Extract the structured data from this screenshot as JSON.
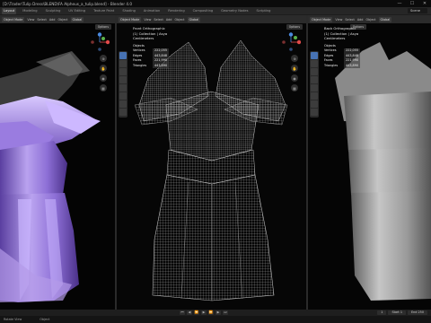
{
  "window": {
    "title": "[D:\\Trader\\Tulip Dress\\BLEND\\FA Alpheus_a_tulip.blend] - Blender 4.0",
    "minimize": "—",
    "maximize": "☐",
    "close": "✕"
  },
  "workspaces": [
    "Layout",
    "Modeling",
    "Sculpting",
    "UV Editing",
    "Texture Paint",
    "Shading",
    "Animation",
    "Rendering",
    "Compositing",
    "Geometry Nodes",
    "Scripting"
  ],
  "active_workspace": "Layout",
  "scene": {
    "name": "Scene",
    "layer": "ViewLayer"
  },
  "left_panel": {
    "header": {
      "mode": "Object Mode",
      "menus": [
        "View",
        "Select",
        "Add",
        "Object"
      ],
      "orientation": "Global"
    },
    "options": "Options"
  },
  "mid_panel": {
    "header": {
      "mode": "Object Mode",
      "menus": [
        "View",
        "Select",
        "Add",
        "Object"
      ],
      "orientation": "Global"
    },
    "options": "Options",
    "view_name": "Front Orthographic",
    "collection": "(1) Collection | Asya",
    "units": "Centimeters",
    "stats": {
      "title": "Objects",
      "rows": [
        {
          "k": "Vertices",
          "v": "222,055"
        },
        {
          "k": "Edges",
          "v": "443,848"
        },
        {
          "k": "Faces",
          "v": "221,990"
        },
        {
          "k": "Triangles",
          "v": "443,890"
        }
      ]
    }
  },
  "right_panel": {
    "header": {
      "mode": "Object Mode",
      "menus": [
        "View",
        "Select",
        "Add",
        "Object"
      ],
      "orientation": "Global"
    },
    "options": "Options",
    "view_name": "Back Orthographic",
    "collection": "(1) Collection | Asya",
    "units": "Centimeters",
    "stats": {
      "title": "Objects",
      "rows": [
        {
          "k": "Vertices",
          "v": "222,055"
        },
        {
          "k": "Edges",
          "v": "443,848"
        },
        {
          "k": "Faces",
          "v": "221,990"
        },
        {
          "k": "Triangles",
          "v": "443,890"
        }
      ]
    }
  },
  "timeline": {
    "buttons": [
      "⏮",
      "◀",
      "⏪",
      "▶",
      "⏩",
      "▶",
      "⏭"
    ],
    "frame": "1",
    "start": "Start 1",
    "end": "End 250"
  },
  "footer": {
    "left": "Rotate View",
    "mid": "Object"
  },
  "colors": {
    "accent": "#4772b3",
    "dress_purple": "#a88ee8",
    "mesh_wire": "#d0d0d0",
    "clay": "#9a9a9a"
  }
}
